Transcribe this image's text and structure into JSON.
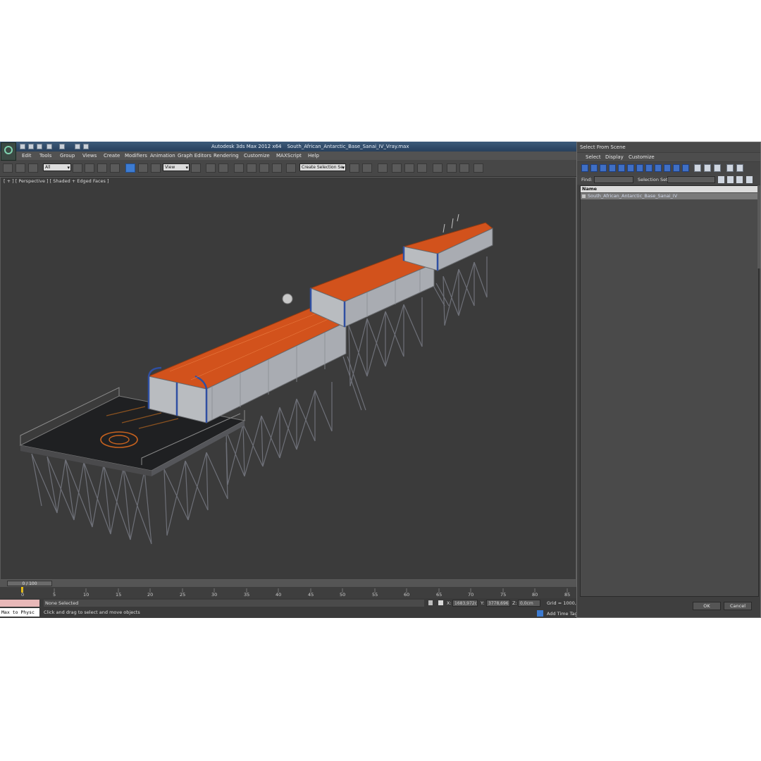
{
  "window": {
    "app_title": "Autodesk 3ds Max  2012 x64",
    "file_name": "South_African_Antarctic_Base_Sanai_IV_Vray.max"
  },
  "menu": [
    "Edit",
    "Tools",
    "Group",
    "Views",
    "Create",
    "Modifiers",
    "Animation",
    "Graph Editors",
    "Rendering",
    "Customize",
    "MAXScript",
    "Help"
  ],
  "toolbar": {
    "selection_filter": "All",
    "reference_coord": "View",
    "named_selection": "Create Selection Se"
  },
  "viewport": {
    "label": "[ + ] [ Perspective ] [ Shaded + Edged Faces ]"
  },
  "timeline": {
    "frame_indicator": "0 / 100",
    "ticks": [
      "0",
      "5",
      "10",
      "15",
      "20",
      "25",
      "30",
      "35",
      "40",
      "45",
      "50",
      "55",
      "60",
      "65",
      "70",
      "75",
      "80",
      "85"
    ]
  },
  "status": {
    "maxscript": "Max to Physc",
    "selection": "None Selected",
    "prompt": "Click and drag to select and move objects",
    "x_label": "X:",
    "x_value": "1683,972c",
    "y_label": "Y:",
    "y_value": "3778,696",
    "z_label": "Z:",
    "z_value": "0,0cm",
    "grid": "Grid = 1000,0c",
    "add_time_tag": "Add Time Tag"
  },
  "dialog": {
    "title": "Select From Scene",
    "menu": [
      "Select",
      "Display",
      "Customize"
    ],
    "find_label": "Find:",
    "selection_set_label": "Selection Set:",
    "column_name": "Name",
    "objects": [
      "South_African_Antarctic_Base_Sanai_IV"
    ],
    "ok_label": "OK",
    "cancel_label": "Cancel"
  }
}
